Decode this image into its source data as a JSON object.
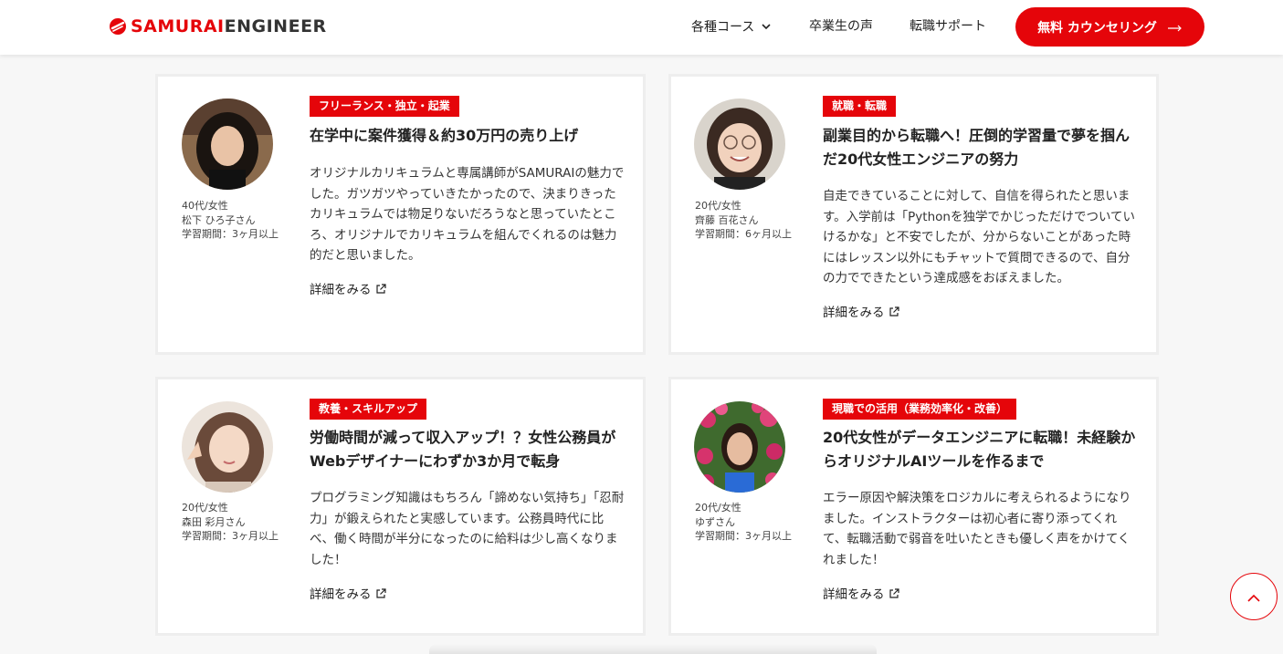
{
  "header": {
    "logo": {
      "part1": "SAMURAI",
      "part2": "ENGINEER"
    },
    "nav": {
      "courses": "各種コース",
      "voices": "卒業生の声",
      "support": "転職サポート"
    },
    "cta": "無料 カウンセリング"
  },
  "colors": {
    "accent": "#e5050a"
  },
  "cards": [
    {
      "tag": "フリーランス・独立・起業",
      "title": "在学中に案件獲得＆約30万円の売り上げ",
      "body": "オリジナルカリキュラムと専属講師がSAMURAIの魅力でした。ガツガツやっていきたかったので、決まりきったカリキュラムでは物足りないだろうなと思っていたところ、オリジナルでカリキュラムを組んでくれるのは魅力的だと思いました。",
      "age": "40代/女性",
      "name": "松下 ひろ子さん",
      "period": "学習期間：3ヶ月以上",
      "more": "詳細をみる"
    },
    {
      "tag": "就職・転職",
      "title": "副業目的から転職へ！圧倒的学習量で夢を掴んだ20代女性エンジニアの努力",
      "body": "自走できていることに対して、自信を得られたと思います。入学前は「Pythonを独学でかじっただけでついていけるかな」と不安でしたが、分からないことがあった時にはレッスン以外にもチャットで質問できるので、自分の力でできたという達成感をおぼえました。",
      "age": "20代/女性",
      "name": "齊藤 百花さん",
      "period": "学習期間：6ヶ月以上",
      "more": "詳細をみる"
    },
    {
      "tag": "教養・スキルアップ",
      "title": "労働時間が減って収入アップ！？女性公務員がWebデザイナーにわずか3か月で転身",
      "body": "プログラミング知識はもちろん「諦めない気持ち」「忍耐力」が鍛えられたと実感しています。公務員時代に比べ、働く時間が半分になったのに給料は少し高くなりました！",
      "age": "20代/女性",
      "name": "森田 彩月さん",
      "period": "学習期間：3ヶ月以上",
      "more": "詳細をみる"
    },
    {
      "tag": "現職での活用（業務効率化・改善）",
      "title": "20代女性がデータエンジニアに転職！未経験からオリジナルAIツールを作るまで",
      "body": "エラー原因や解決策をロジカルに考えられるようになりました。インストラクターは初心者に寄り添ってくれて、転職活動で弱音を吐いたときも優しく声をかけてくれました！",
      "age": "20代/女性",
      "name": "ゆずさん",
      "period": "学習期間：3ヶ月以上",
      "more": "詳細をみる"
    }
  ]
}
